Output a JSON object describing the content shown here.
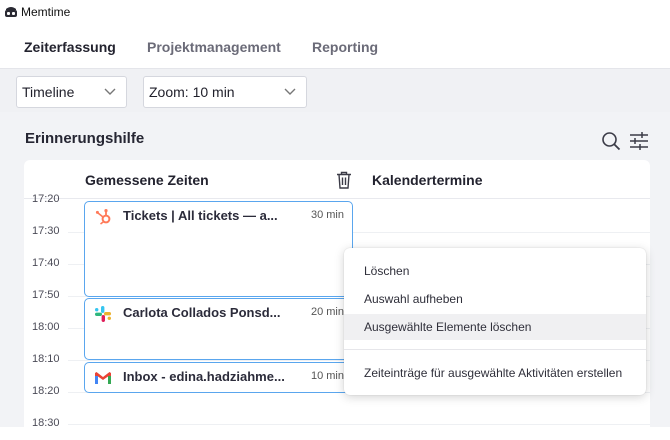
{
  "window": {
    "title": "Memtime"
  },
  "nav": {
    "tabs": [
      {
        "label": "Zeiterfassung",
        "active": true
      },
      {
        "label": "Projektmanagement",
        "active": false
      },
      {
        "label": "Reporting",
        "active": false
      }
    ]
  },
  "toolbar": {
    "view_select": "Timeline",
    "zoom_select": "Zoom: 10 min"
  },
  "section": {
    "title": "Erinnerungshilfe"
  },
  "columns": {
    "measured": "Gemessene Zeiten",
    "calendar": "Kalendertermine"
  },
  "times": [
    "17:20",
    "17:30",
    "17:40",
    "17:50",
    "18:00",
    "18:10",
    "18:20",
    "18:30"
  ],
  "entries": [
    {
      "title": "Tickets | All tickets — a...",
      "duration": "30 min",
      "app_icon": "hubspot-icon"
    },
    {
      "title": "Carlota Collados Ponsd...",
      "duration": "20 min",
      "app_icon": "slack-icon"
    },
    {
      "title": "Inbox - edina.hadziahme...",
      "duration": "10 min",
      "app_icon": "gmail-icon"
    }
  ],
  "context_menu": {
    "items": [
      "Löschen",
      "Auswahl aufheben",
      "Ausgewählte Elemente löschen",
      "Zeiteinträge für ausgewählte Aktivitäten erstellen"
    ],
    "hovered_index": 2
  },
  "colors": {
    "accent": "#5aa6ee",
    "hubspot": "#ff7a59",
    "gmail": "#ea4335"
  }
}
